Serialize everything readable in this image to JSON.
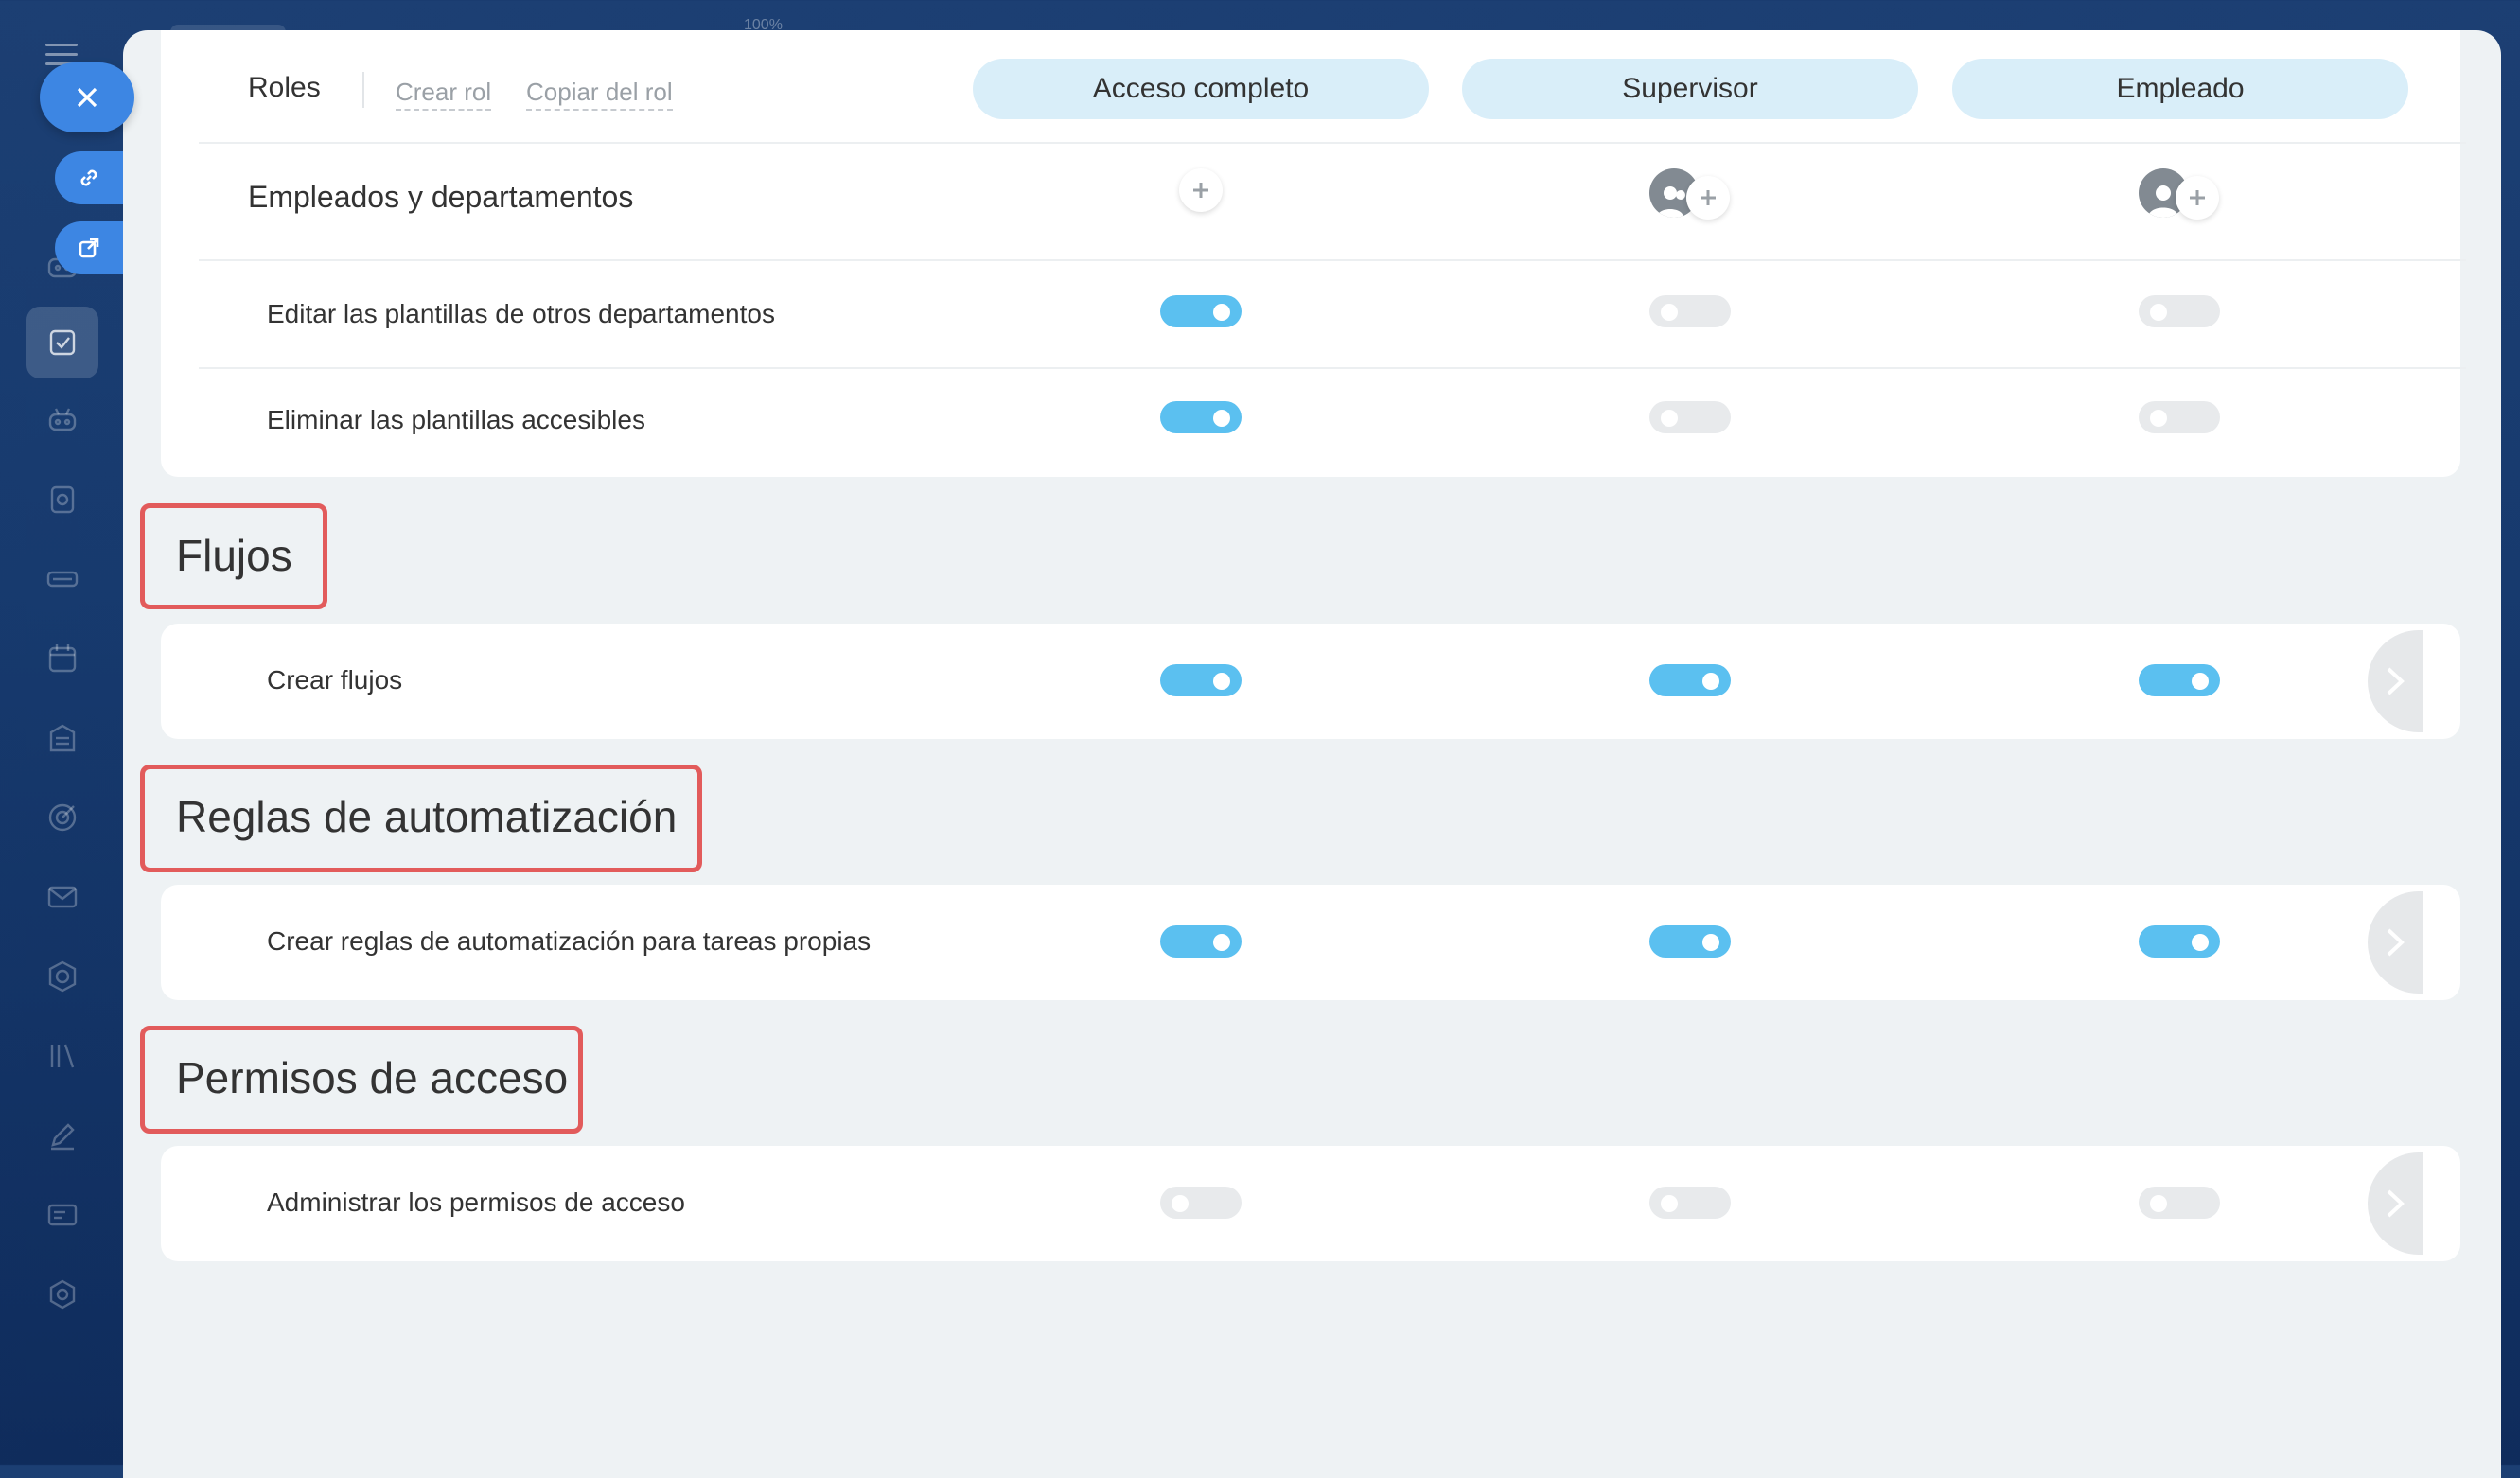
{
  "app": {
    "zoom_label": "100%"
  },
  "header": {
    "title": "Roles",
    "create_role": "Crear rol",
    "copy_role": "Copiar del rol"
  },
  "roles": [
    "Acceso completo",
    "Supervisor",
    "Empleado"
  ],
  "assignment_row": {
    "label": "Empleados y departamentos"
  },
  "templates_rows": [
    {
      "label": "Editar las plantillas de otros departamentos",
      "values": [
        true,
        false,
        false
      ]
    },
    {
      "label": "Eliminar las plantillas accesibles",
      "values": [
        true,
        false,
        false
      ]
    }
  ],
  "sections": [
    {
      "title": "Flujos",
      "rows": [
        {
          "label": "Crear flujos",
          "values": [
            true,
            true,
            true
          ]
        }
      ]
    },
    {
      "title": "Reglas de automatización",
      "rows": [
        {
          "label": "Crear reglas de automatización para tareas propias",
          "values": [
            true,
            true,
            true
          ]
        }
      ]
    },
    {
      "title": "Permisos de acceso",
      "rows": [
        {
          "label": "Administrar los permisos de acceso",
          "values": [
            false,
            false,
            false
          ]
        }
      ]
    }
  ],
  "colors": {
    "toggle_on": "#5bc0f0",
    "toggle_off": "#e8eaec",
    "role_pill": "#d9eef9",
    "highlight": "#e25b5b",
    "accent": "#3d86e3"
  },
  "icons": [
    "menu-icon",
    "close-icon",
    "link-icon",
    "open-external-icon",
    "tasks-icon",
    "robot-icon",
    "gallery-icon",
    "drive-icon",
    "calendar-icon",
    "store-icon",
    "target-icon",
    "mail-icon",
    "hexagon-icon",
    "library-icon",
    "pen-icon",
    "card-icon",
    "settings-icon",
    "plus-icon",
    "user-group-icon",
    "user-icon",
    "chevron-right-icon"
  ]
}
